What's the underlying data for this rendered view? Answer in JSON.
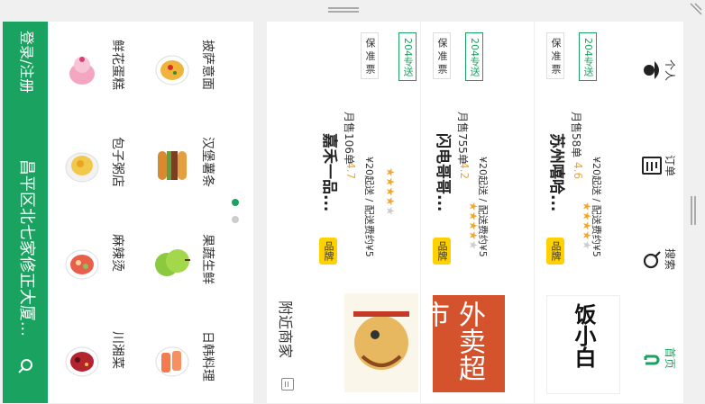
{
  "search": {
    "location": "昌平区北七家修正大厦...",
    "login": "登录/注册"
  },
  "categories": [
    {
      "label": "鲜花蛋糕",
      "icon": "cupcake-icon"
    },
    {
      "label": "包子粥店",
      "icon": "bun-porridge-icon"
    },
    {
      "label": "麻辣烫",
      "icon": "spicy-hotpot-icon"
    },
    {
      "label": "川湘菜",
      "icon": "sichuan-dish-icon"
    },
    {
      "label": "披萨意面",
      "icon": "pasta-icon"
    },
    {
      "label": "汉堡薯条",
      "icon": "burger-icon"
    },
    {
      "label": "果蔬生鲜",
      "icon": "apple-icon"
    },
    {
      "label": "日韩料理",
      "icon": "sushi-icon"
    }
  ],
  "nearby_title": "附近商家",
  "merchants": [
    {
      "badge": "品牌",
      "name": "嘉禾一品...",
      "rating": "4.7",
      "stars": 4.7,
      "monthly": "月售106单",
      "min_order": "¥20起送 / 配送费约¥5",
      "tags": [
        "保",
        "准",
        "票"
      ],
      "delivery": "204专送"
    },
    {
      "badge": "品牌",
      "name": "闪电哥哥...",
      "rating": "4.2",
      "stars": 4.2,
      "monthly": "月售755单",
      "min_order": "¥20起送 / 配送费约¥5",
      "tags": [
        "保",
        "准",
        "票"
      ],
      "delivery": "204专送"
    },
    {
      "badge": "品牌",
      "name": "苏州嘻哈...",
      "rating": "4.6",
      "stars": 4.6,
      "monthly": "月售58单",
      "min_order": "¥20起送 / 配送费约¥5",
      "tags": [
        "保",
        "准",
        "票"
      ],
      "delivery": "204专送"
    }
  ],
  "logo_texts": [
    "外卖超市",
    "饭小白"
  ],
  "tabbar": [
    {
      "label": "首页",
      "icon": "home-icon",
      "active": true
    },
    {
      "label": "搜索",
      "icon": "search-icon",
      "active": false
    },
    {
      "label": "订单",
      "icon": "order-icon",
      "active": false
    },
    {
      "label": "个人",
      "icon": "person-icon",
      "active": false
    }
  ],
  "colors": {
    "brand_green": "#1aa260",
    "rating_orange": "#f5a623",
    "badge_yellow": "#ffd100",
    "active_tab": "#1aa260"
  }
}
